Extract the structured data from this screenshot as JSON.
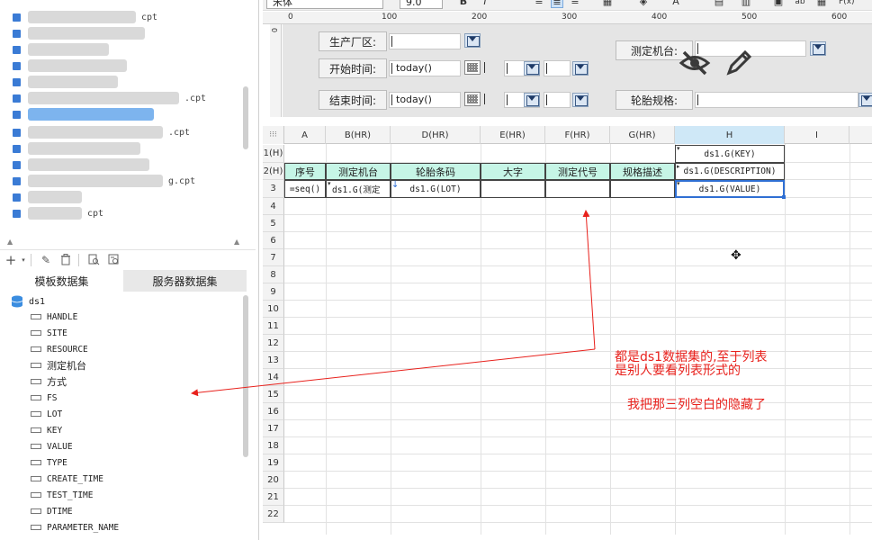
{
  "file_tree": {
    "items": [
      {
        "suffix": "cpt"
      },
      {
        "suffix": ""
      },
      {
        "suffix": ""
      },
      {
        "suffix": ""
      },
      {
        "suffix": ""
      },
      {
        "suffix": ".cpt"
      },
      {
        "suffix": ""
      },
      {
        "suffix": ".cpt"
      },
      {
        "suffix": ""
      },
      {
        "suffix": ""
      },
      {
        "suffix": "g.cpt"
      },
      {
        "suffix": ""
      },
      {
        "suffix": "cpt"
      }
    ]
  },
  "dataset_panel": {
    "tabs": [
      {
        "label": "模板数据集"
      },
      {
        "label": "服务器数据集"
      }
    ],
    "dataset": {
      "name": "ds1",
      "fields": [
        "HANDLE",
        "SITE",
        "RESOURCE",
        "测定机台",
        "方式",
        "FS",
        "LOT",
        "KEY",
        "VALUE",
        "TYPE",
        "CREATE_TIME",
        "TEST_TIME",
        "DTIME",
        "PARAMETER_NAME"
      ]
    }
  },
  "format_bar": {
    "font_name": "宋体",
    "font_size": "9.0"
  },
  "ruler": {
    "marks": [
      "0",
      "100",
      "200",
      "300",
      "400",
      "500",
      "600"
    ],
    "vertical_marks": [
      "0"
    ]
  },
  "params": {
    "factory_label": "生产厂区:",
    "machine_label": "测定机台:",
    "start_label": "开始时间:",
    "start_value": "today()",
    "end_label": "结束时间:",
    "end_value": "today()",
    "tire_spec_label": "轮胎规格:"
  },
  "sheet": {
    "corner": "",
    "columns": [
      {
        "label": "A"
      },
      {
        "label": "B(HR)"
      },
      {
        "label": "D(HR)"
      },
      {
        "label": "E(HR)"
      },
      {
        "label": "F(HR)"
      },
      {
        "label": "G(HR)"
      },
      {
        "label": "H"
      },
      {
        "label": "I"
      }
    ],
    "rows": [
      "1(H)",
      "2(H)",
      "3",
      "4",
      "5",
      "6",
      "7",
      "8",
      "9",
      "10",
      "11",
      "12",
      "13",
      "14",
      "15",
      "16",
      "17",
      "18",
      "19",
      "20",
      "21",
      "22"
    ],
    "cells": {
      "h1": "ds1.G(KEY)",
      "a2": "序号",
      "b2": "测定机台",
      "d2": "轮胎条码",
      "e2": "大字",
      "f2": "测定代号",
      "g2": "规格描述",
      "h2": "ds1.G(DESCRIPTION)",
      "a3": "=seq()",
      "b3": "ds1.G(测定",
      "d3": "ds1.G(LOT)",
      "h3": "ds1.G(VALUE)"
    }
  },
  "annotation": {
    "line1": "都是ds1数据集的,至于列表",
    "line2": "是别人要看列表形式的",
    "line3": "我把那三列空白的隐藏了",
    "color": "#e8211c"
  }
}
